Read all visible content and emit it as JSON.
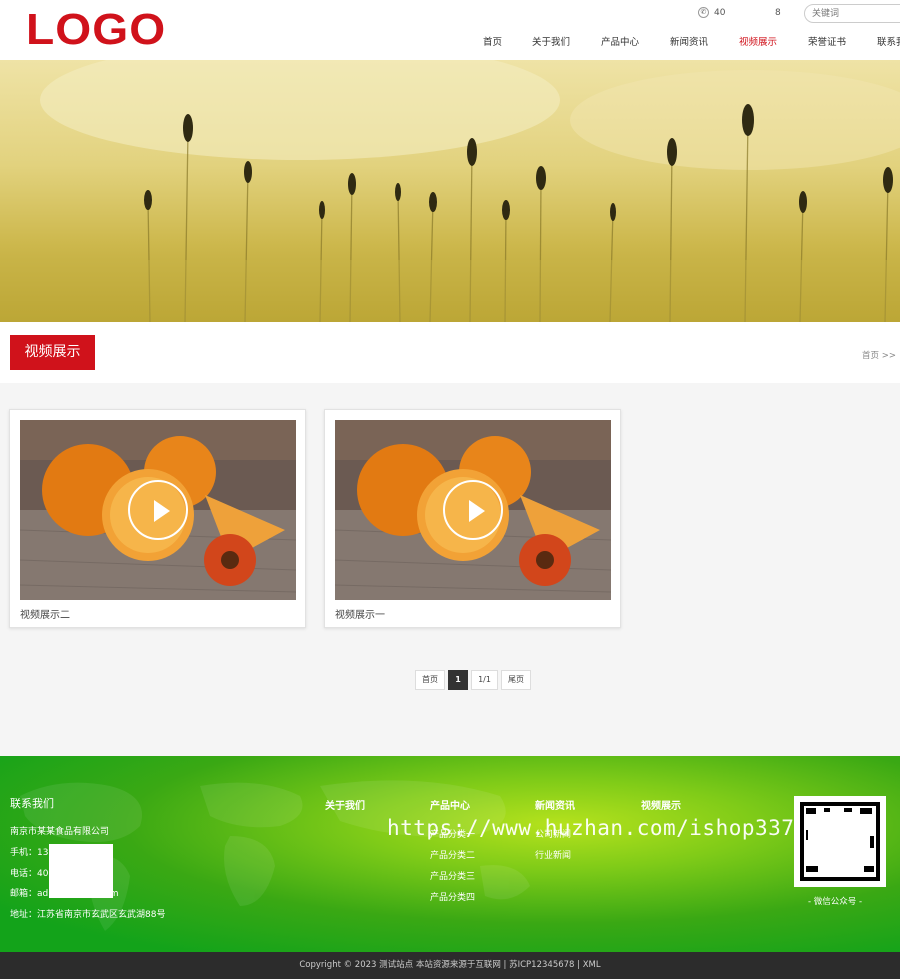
{
  "header": {
    "logo": "LOGO",
    "phone": "40",
    "phone_tail": "8",
    "search_placeholder": "关键词",
    "nav": [
      "首页",
      "关于我们",
      "产品中心",
      "新闻资讯",
      "视频展示",
      "荣誉证书",
      "联系我们"
    ],
    "active_nav": "视频展示"
  },
  "section": {
    "title": "视频展示",
    "breadcrumb": "首页 >>"
  },
  "videos": [
    {
      "title": "视频展示二"
    },
    {
      "title": "视频展示一"
    }
  ],
  "pagination": {
    "first": "首页",
    "current": "1",
    "pages": "1/1",
    "last": "尾页"
  },
  "footer": {
    "contact_heading": "联系我们",
    "company": "南京市某某食品有限公司",
    "mobile": "手机：13",
    "tel": "电话：40",
    "email_prefix": "邮箱：ad",
    "email_suffix": "com",
    "address": "地址：江苏省南京市玄武区玄武湖88号",
    "columns": [
      {
        "heading": "关于我们",
        "links": []
      },
      {
        "heading": "产品中心",
        "links": [
          "产品分类一",
          "产品分类二",
          "产品分类三",
          "产品分类四"
        ]
      },
      {
        "heading": "新闻资讯",
        "links": [
          "公司新闻",
          "行业新闻"
        ]
      },
      {
        "heading": "视频展示",
        "links": []
      }
    ],
    "watermark": "https://www.huzhan.com/ishop33781",
    "qr_label": "- 微信公众号 -"
  },
  "copyright": "Copyright © 2023 测试站点 本站资源来源于互联网  |  苏ICP12345678  |  XML",
  "colors": {
    "brand_red": "#d0121b",
    "footer_green": "#13a31a",
    "copyright_bg": "#2c2c2c"
  }
}
